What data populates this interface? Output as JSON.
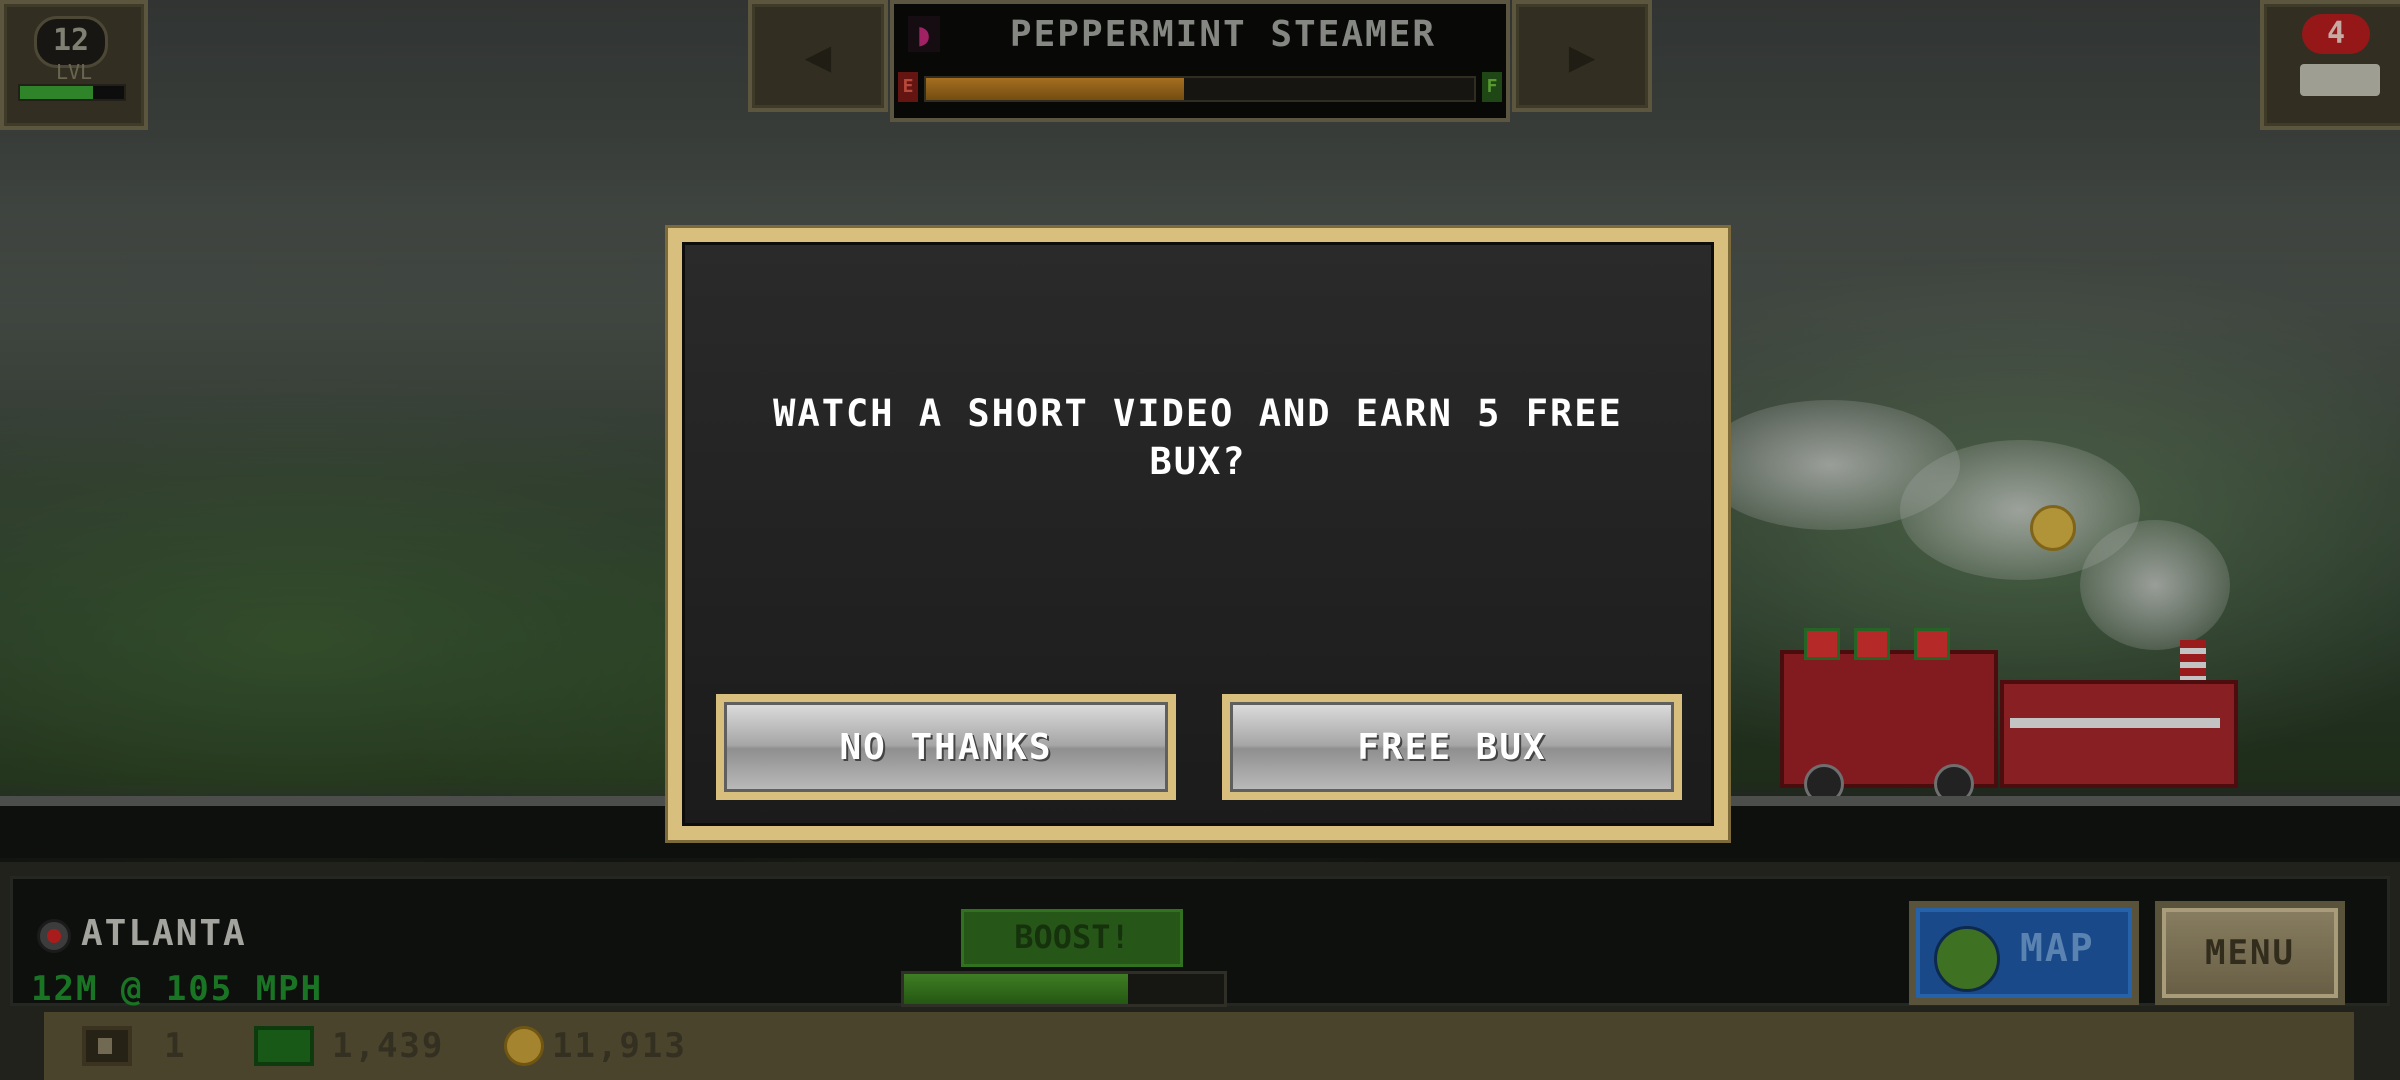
{
  "level": {
    "value": "12",
    "label": "LVL",
    "xp_progress": 0.7
  },
  "train_selector": {
    "prev_icon": "left-arrow",
    "next_icon": "right-arrow",
    "train_name": "PEPPERMINT STEAMER",
    "fuel_empty_label": "E",
    "fuel_full_label": "F",
    "fuel_level": 0.47
  },
  "tickets_badge": {
    "count": "4",
    "icon": "train-icon"
  },
  "dialog": {
    "message": "WATCH A SHORT VIDEO AND EARN 5 FREE BUX?",
    "decline_label": "NO THANKS",
    "accept_label": "FREE BUX"
  },
  "hud": {
    "city": "ATLANTA",
    "distance_speed": "12M @ 105 MPH",
    "boost_label": "BOOST!",
    "boost_level": 0.7,
    "map_label": "MAP",
    "menu_label": "MENU",
    "tickets_count": "1",
    "bux": "1,439",
    "coins": "11,913"
  },
  "colors": {
    "dialog_frame": "#d9bf7e",
    "hud_green": "#1f8f2c",
    "map_blue": "#1f5aa8",
    "alert_red": "#b81d1d"
  }
}
